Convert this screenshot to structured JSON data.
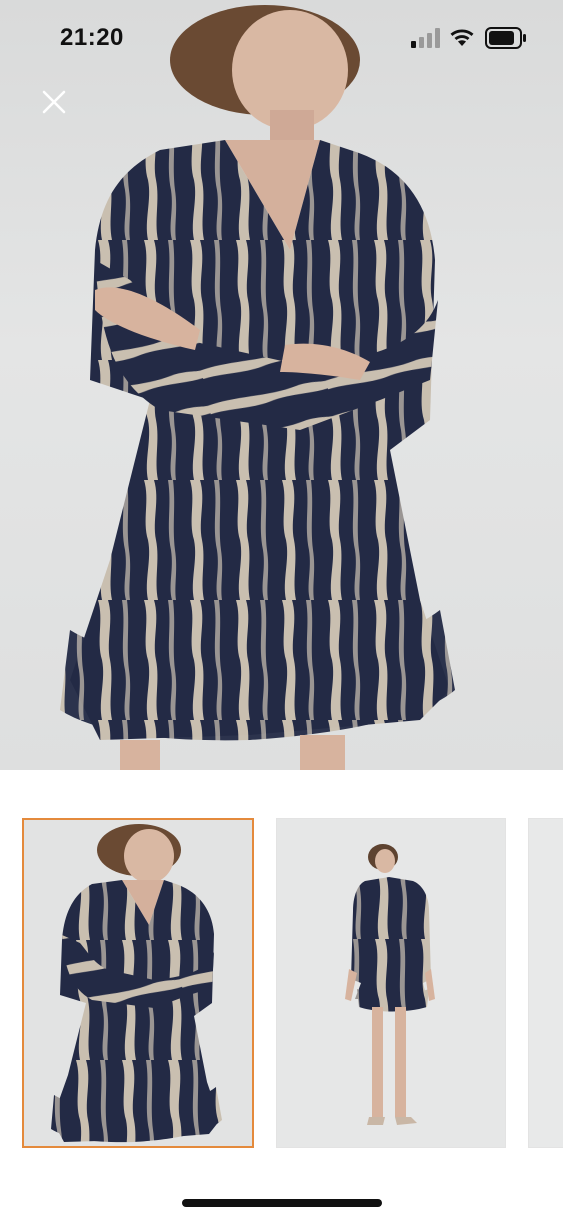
{
  "status_bar": {
    "time": "21:20",
    "icons": [
      "signal-icon",
      "wifi-icon",
      "battery-icon"
    ]
  },
  "viewer": {
    "close_icon": "close-icon",
    "main_image": "product-photo-front-closeup"
  },
  "thumbnails": [
    {
      "name": "product-photo-front-closeup",
      "selected": true
    },
    {
      "name": "product-photo-full-length",
      "selected": false
    },
    {
      "name": "product-photo-partial",
      "selected": false
    }
  ],
  "colors": {
    "dress_navy": "#232a45",
    "dress_beige": "#c9bfb0",
    "selected_border": "#e48a3c",
    "background": "#e2e3e3"
  }
}
